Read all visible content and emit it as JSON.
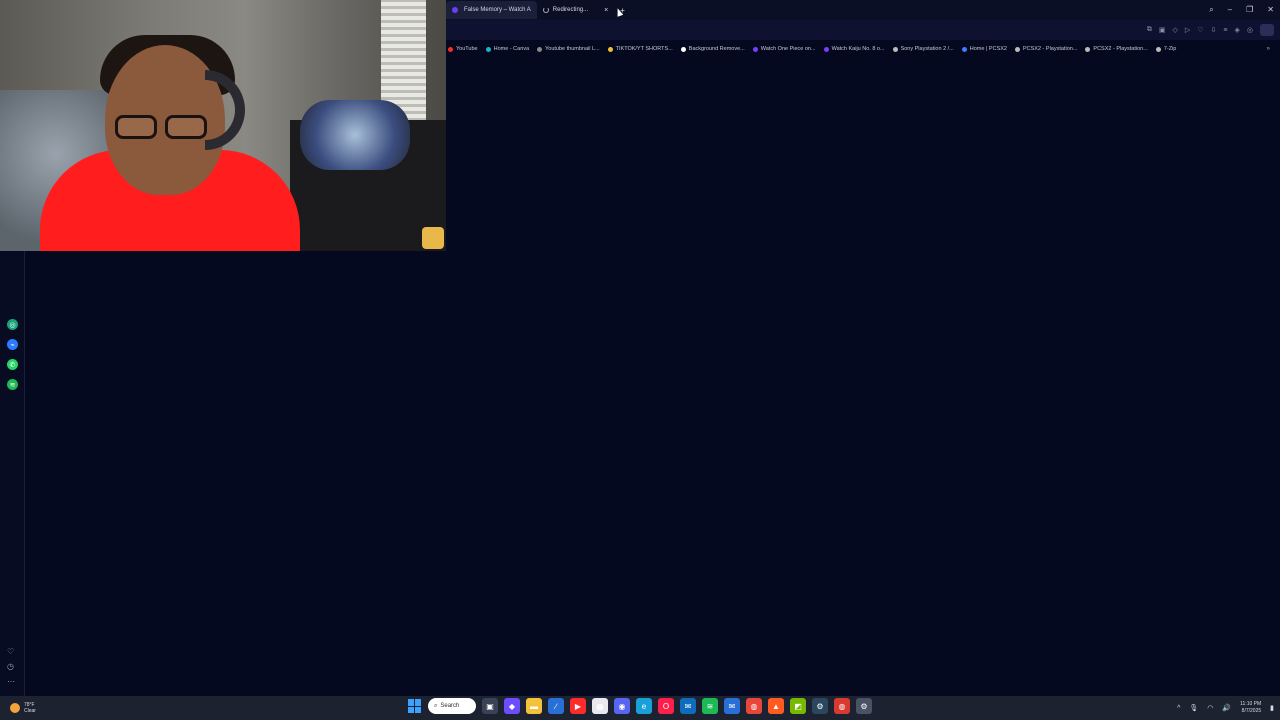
{
  "browser": {
    "tabs": [
      {
        "title": "False Memory – Watch A",
        "active": true
      },
      {
        "title": "Redirecting...",
        "active": false
      }
    ],
    "close_glyph": "×",
    "new_tab_glyph": "+",
    "window_controls": {
      "search": "⌕",
      "minimize": "–",
      "restore": "❐",
      "close": "✕"
    }
  },
  "bookmarks": [
    {
      "label": "YouTube",
      "color": "#ff2a2a"
    },
    {
      "label": "Home - Canva",
      "color": "#19b6c8"
    },
    {
      "label": "Youtube thumbnail L...",
      "color": "#888888"
    },
    {
      "label": "TIKTOK/YT SHORTS...",
      "color": "#f2c12e"
    },
    {
      "label": "Background Remove...",
      "color": "#ffffff"
    },
    {
      "label": "Watch One Piece on...",
      "color": "#7a3cff"
    },
    {
      "label": "Watch Kaiju No. 8 o...",
      "color": "#7a3cff"
    },
    {
      "label": "Sony Playstation 2 /...",
      "color": "#bbbbbb"
    },
    {
      "label": "Home | PCSX2",
      "color": "#3d7bff"
    },
    {
      "label": "PCSX2 - Playstation...",
      "color": "#bbbbbb"
    },
    {
      "label": "PCSX2 - Playstation...",
      "color": "#bbbbbb"
    },
    {
      "label": "7-Zip",
      "color": "#bbbbbb"
    }
  ],
  "bookmarks_more": "»",
  "sidebar": {
    "apps": [
      {
        "name": "chatgpt",
        "color": "#1aa37a",
        "glyph": "◎"
      },
      {
        "name": "messenger",
        "color": "#2a7bff",
        "glyph": "⌁"
      },
      {
        "name": "whatsapp",
        "color": "#25d366",
        "glyph": "✆"
      },
      {
        "name": "spotify",
        "color": "#1db954",
        "glyph": "≋"
      }
    ],
    "bottom": {
      "heart": "♡",
      "clock": "◷",
      "more": "⋯"
    }
  },
  "taskbar": {
    "weather": {
      "temp": "78°F",
      "condition": "Clear"
    },
    "search_label": "Search",
    "apps": [
      {
        "name": "task-view",
        "color": "#3a4256",
        "glyph": "▣"
      },
      {
        "name": "copilot",
        "color": "#6b4cff",
        "glyph": "◆"
      },
      {
        "name": "file-explorer",
        "color": "#f3c23a",
        "glyph": "▬"
      },
      {
        "name": "visual-studio-code",
        "color": "#2a6fd6",
        "glyph": "∕"
      },
      {
        "name": "youtube",
        "color": "#ff2a2a",
        "glyph": "▶"
      },
      {
        "name": "calendar",
        "color": "#e8e8ee",
        "glyph": "▦"
      },
      {
        "name": "discord",
        "color": "#5865f2",
        "glyph": "◉"
      },
      {
        "name": "edge",
        "color": "#1aa0d8",
        "glyph": "e"
      },
      {
        "name": "opera-gx",
        "color": "#ff1f4a",
        "glyph": "O"
      },
      {
        "name": "outlook",
        "color": "#0f6cbd",
        "glyph": "✉"
      },
      {
        "name": "spotify",
        "color": "#1db954",
        "glyph": "≋"
      },
      {
        "name": "mail",
        "color": "#2a6fd6",
        "glyph": "✉"
      },
      {
        "name": "chrome",
        "color": "#e8463a",
        "glyph": "◍"
      },
      {
        "name": "brave",
        "color": "#ff5a1f",
        "glyph": "▲"
      },
      {
        "name": "nvidia",
        "color": "#76b900",
        "glyph": "◩"
      },
      {
        "name": "steam",
        "color": "#2a475e",
        "glyph": "⚙"
      },
      {
        "name": "chrome-2",
        "color": "#d93a2f",
        "glyph": "◍"
      },
      {
        "name": "settings",
        "color": "#4a5266",
        "glyph": "⚙"
      }
    ],
    "tray": {
      "chevron": "^",
      "mic": "🎙",
      "wifi": "◠",
      "volume": "🔊",
      "time": "11:10 PM",
      "date": "8/7/2025",
      "battery": "▮"
    }
  }
}
